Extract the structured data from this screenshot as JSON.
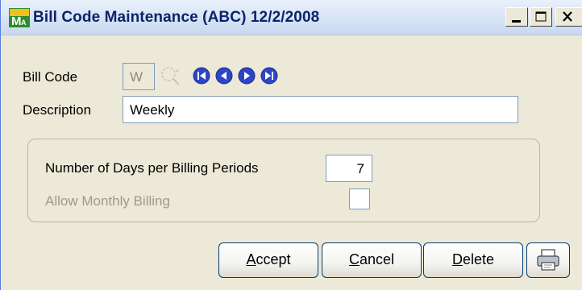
{
  "window": {
    "title": "Bill Code Maintenance (ABC) 12/2/2008",
    "controls": [
      "minimize",
      "maximize",
      "close"
    ]
  },
  "form": {
    "bill_code_label": "Bill Code",
    "bill_code_value": "W",
    "description_label": "Description",
    "description_value": "Weekly",
    "days_label": "Number of Days per Billing Periods",
    "days_value": "7",
    "monthly_label": "Allow Monthly Billing",
    "monthly_checked": false
  },
  "buttons": {
    "accept": {
      "mnemonic": "A",
      "rest": "ccept"
    },
    "cancel": {
      "mnemonic": "C",
      "rest": "ancel"
    },
    "delete": {
      "mnemonic": "D",
      "rest": "elete"
    },
    "print_icon": "printer-icon"
  },
  "icons": {
    "app": "mas90-app-icon",
    "lookup": "lookup-icon",
    "nav": [
      "nav-first-icon",
      "nav-previous-icon",
      "nav-next-icon",
      "nav-last-icon"
    ]
  },
  "colors": {
    "window_bg": "#ece9d8",
    "titlebar_text": "#0a246a",
    "nav_blue": "#2f45c7",
    "button_border": "#003c74"
  }
}
